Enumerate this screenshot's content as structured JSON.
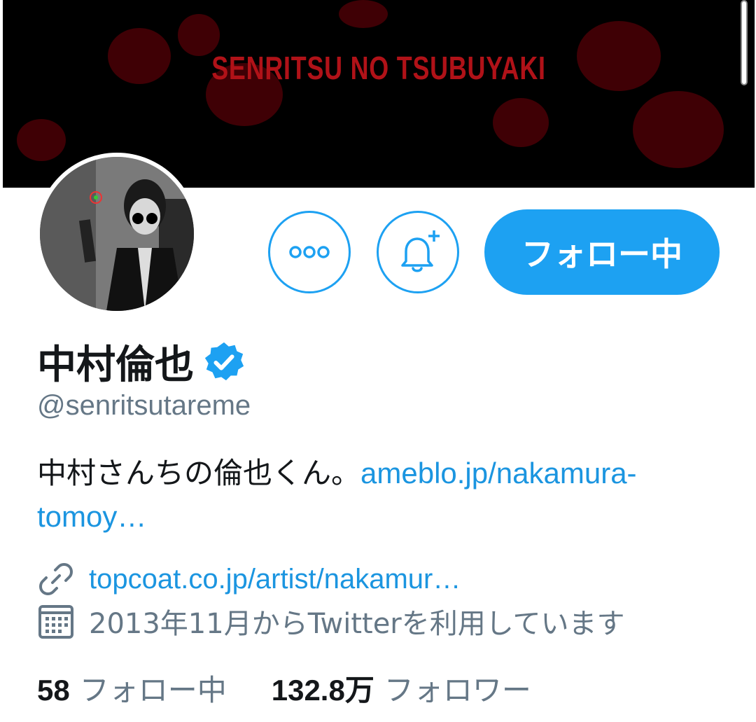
{
  "banner": {
    "title": "SENRITSU NO TSUBUYAKI"
  },
  "profile": {
    "display_name": "中村倫也",
    "handle": "@senritsutareme",
    "bio_text": "中村さんちの倫也くん。",
    "bio_link": "ameblo.jp/nakamura-tomoy…",
    "website": "topcoat.co.jp/artist/nakamur…",
    "joined": "2013年11月からTwitterを利用しています"
  },
  "actions": {
    "follow_label": "フォロー中"
  },
  "stats": {
    "following_count": "58",
    "following_label": "フォロー中",
    "followers_count": "132.8万",
    "followers_label": "フォロワー"
  },
  "colors": {
    "accent": "#1da1f2",
    "link": "#1b95e0",
    "muted": "#657786",
    "banner_text": "#b01218"
  },
  "icons": [
    "more-icon",
    "bell-plus-icon",
    "verified-icon",
    "link-icon",
    "calendar-icon"
  ]
}
